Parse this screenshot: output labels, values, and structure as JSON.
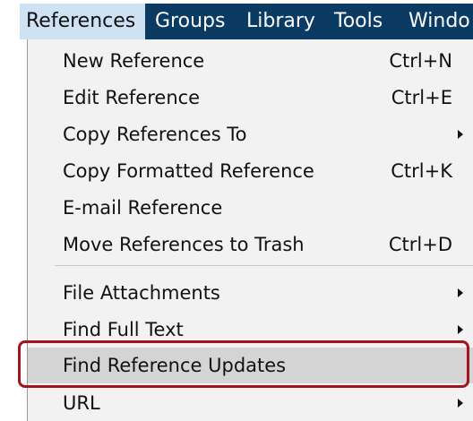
{
  "menubar": {
    "items": [
      {
        "label": "References",
        "active": true
      },
      {
        "label": "Groups",
        "active": false
      },
      {
        "label": "Library",
        "active": false
      },
      {
        "label": "Tools",
        "active": false
      },
      {
        "label": "Windo",
        "active": false
      }
    ]
  },
  "references_menu": {
    "items": [
      {
        "label": "New Reference",
        "shortcut": "Ctrl+N"
      },
      {
        "label": "Edit Reference",
        "shortcut": "Ctrl+E"
      },
      {
        "label": "Copy References To",
        "submenu": true
      },
      {
        "label": "Copy Formatted Reference",
        "shortcut": "Ctrl+K"
      },
      {
        "label": "E-mail Reference"
      },
      {
        "label": "Move References to Trash",
        "shortcut": "Ctrl+D"
      },
      {
        "label": "File Attachments",
        "submenu": true
      },
      {
        "label": "Find Full Text",
        "submenu": true
      },
      {
        "label": "Find Reference Updates",
        "highlighted": true
      },
      {
        "label": "URL",
        "submenu": true
      }
    ]
  },
  "icons": {
    "submenu_arrow": "chevron-right-icon"
  },
  "colors": {
    "menubar_background": "#0b3a63",
    "menubar_active_background": "#cfe2f4",
    "dropdown_background": "#f2f2f2",
    "highlight_background": "#d4d4d4",
    "annotation_border": "#a4141c"
  }
}
